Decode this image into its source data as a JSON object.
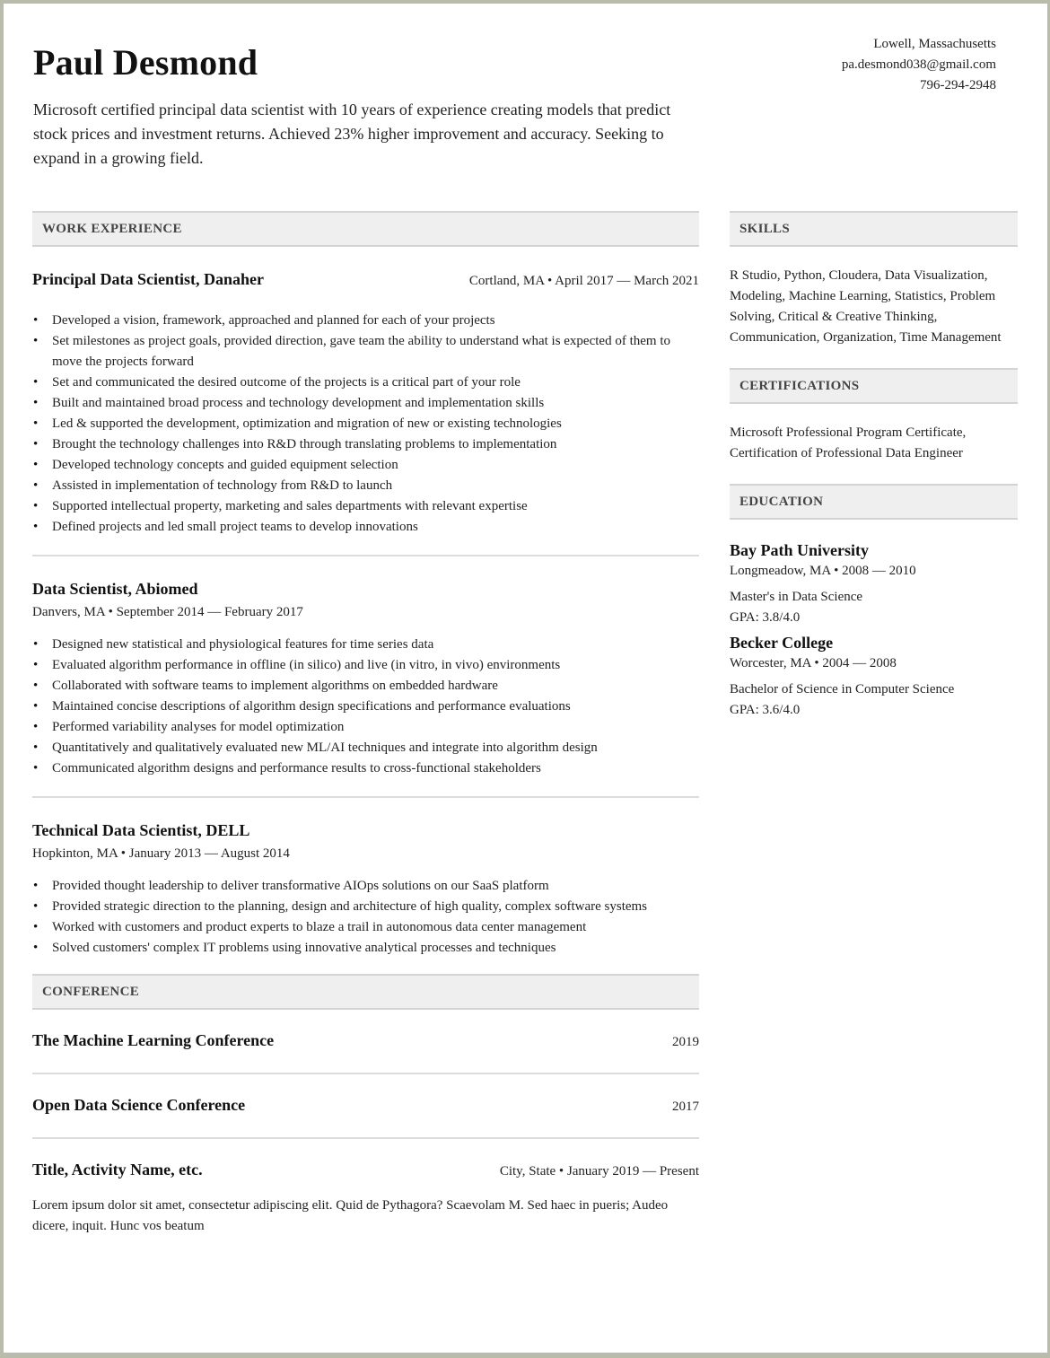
{
  "header": {
    "name": "Paul Desmond",
    "contact": {
      "location": "Lowell, Massachusetts",
      "email": "pa.desmond038@gmail.com",
      "phone": "796-294-2948"
    },
    "summary": "Microsoft certified principal data scientist with 10 years of experience creating models that predict stock prices and investment returns. Achieved 23% higher improvement and accuracy. Seeking to expand in a growing field."
  },
  "work_experience": {
    "heading": "WORK EXPERIENCE",
    "jobs": [
      {
        "title": "Principal Data Scientist, Danaher",
        "meta": "Cortland, MA • April 2017 — March 2021",
        "bullets": [
          "Developed a vision, framework, approached and planned for each of your projects",
          "Set milestones as project goals, provided direction, gave team the ability to understand what is expected of them to move the projects forward",
          "Set and communicated the desired outcome of the projects is a critical part of your role",
          "Built and maintained broad process and technology development and implementation skills",
          "Led & supported the development, optimization and migration of new or existing technologies",
          "Brought the technology challenges into R&D through translating problems to implementation",
          "Developed technology concepts and guided equipment selection",
          "Assisted in implementation of technology from R&D to launch",
          "Supported intellectual property, marketing and sales departments with relevant expertise",
          "Defined projects and led small project teams to develop innovations"
        ]
      },
      {
        "title": "Data Scientist, Abiomed",
        "meta": "Danvers, MA • September 2014 — February 2017",
        "bullets": [
          "Designed new statistical and physiological features for time series data",
          "Evaluated algorithm performance in offline (in silico) and live (in vitro, in vivo) environments",
          "Collaborated with software teams to implement algorithms on embedded hardware",
          "Maintained concise descriptions of algorithm design specifications and performance evaluations",
          "Performed variability analyses for model optimization",
          "Quantitatively and qualitatively evaluated new ML/AI techniques and integrate into algorithm design",
          "Communicated algorithm designs and performance results to cross-functional stakeholders"
        ]
      },
      {
        "title": "Technical Data Scientist, DELL",
        "meta": "Hopkinton, MA • January 2013 — August 2014",
        "bullets": [
          "Provided thought leadership to deliver transformative AIOps solutions on our SaaS platform",
          "Provided strategic direction to the planning, design and architecture of high quality, complex software systems",
          "Worked with customers and product experts to blaze a trail in autonomous data center management",
          "Solved customers' complex IT problems using innovative analytical processes and techniques"
        ]
      }
    ]
  },
  "conference": {
    "heading": "CONFERENCE",
    "items": [
      {
        "title": "The Machine Learning Conference",
        "year": "2019"
      },
      {
        "title": "Open Data Science Conference",
        "year": "2017"
      }
    ],
    "activity": {
      "title": "Title, Activity Name, etc.",
      "meta": "City, State • January 2019 — Present",
      "description": "Lorem ipsum dolor sit amet, consectetur adipiscing elit. Quid de Pythagora? Scaevolam M. Sed haec in pueris; Audeo dicere, inquit. Hunc vos beatum"
    }
  },
  "skills": {
    "heading": "SKILLS",
    "text": "R Studio, Python, Cloudera, Data Visualization, Modeling, Machine Learning, Statistics, Problem Solving, Critical & Creative Thinking, Communication, Organization, Time Management"
  },
  "certifications": {
    "heading": "CERTIFICATIONS",
    "text": "Microsoft Professional Program Certificate, Certification of Professional Data Engineer"
  },
  "education": {
    "heading": "EDUCATION",
    "schools": [
      {
        "name": "Bay Path University",
        "meta": "Longmeadow, MA • 2008 — 2010",
        "degree": "Master's in Data Science",
        "gpa": "GPA: 3.8/4.0"
      },
      {
        "name": "Becker College",
        "meta": "Worcester, MA • 2004 — 2008",
        "degree": "Bachelor of Science in Computer Science",
        "gpa": "GPA: 3.6/4.0"
      }
    ]
  }
}
